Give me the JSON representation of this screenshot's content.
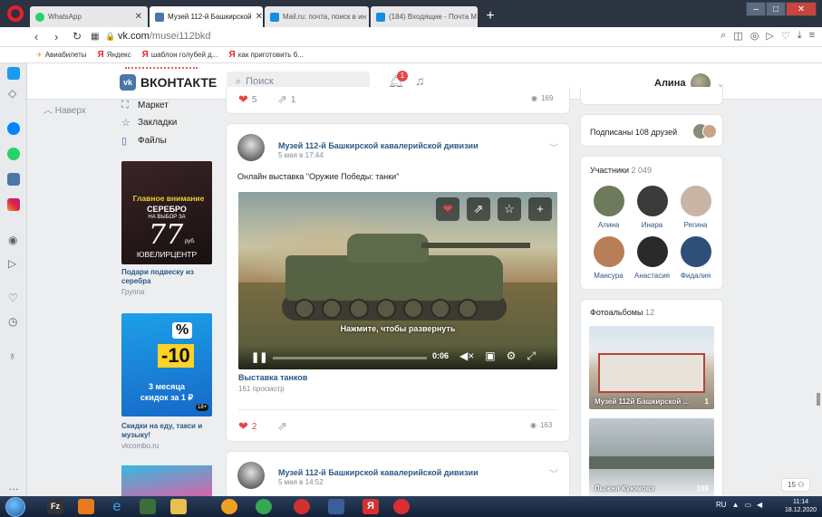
{
  "browser": {
    "tabs": [
      {
        "label": "WhatsApp",
        "color": "#25d366",
        "active": false
      },
      {
        "label": "Музей 112-й Башкирской",
        "color": "#4a76a8",
        "active": true
      },
      {
        "label": "Mail.ru: почта, поиск в ин",
        "color": "#168de2",
        "active": false
      },
      {
        "label": "(184) Входящие - Почта М",
        "color": "#168de2",
        "active": false
      }
    ],
    "new_tab": "+",
    "url_host": "vk.com",
    "url_path": "/musei112bkd",
    "bookmarks": [
      {
        "label": "Авиабилеты",
        "icon": "plane-icon"
      },
      {
        "label": "Яндекс",
        "icon": "yandex-icon"
      },
      {
        "label": "шаблон голубей д...",
        "icon": "yandex-icon"
      },
      {
        "label": "как приготовить б...",
        "icon": "yandex-icon"
      }
    ]
  },
  "vk": {
    "logo": "ВКОНТАКТЕ",
    "logo_mark": "vk",
    "search_placeholder": "Поиск",
    "notifications": "1",
    "user_name": "Алина",
    "back_top": "Наверх",
    "menu": [
      {
        "label": "Маркет",
        "icon": "bag-icon"
      },
      {
        "label": "Закладки",
        "icon": "star-icon"
      },
      {
        "label": "Файлы",
        "icon": "file-icon"
      }
    ],
    "ads": [
      {
        "img_line1": "Главное внимание",
        "img_line2": "СЕРЕБРО",
        "img_line3": "НА ВЫБОР ЗА",
        "img_price": "77",
        "img_unit": "руб.",
        "img_brand": "ЮВЕЛИРЦЕНТР",
        "title": "Подари подвеску из серебра",
        "sub": "Группа"
      },
      {
        "img_pct": "%",
        "img_big": "-10",
        "img_t1": "3 месяца",
        "img_t2": "скидок за 1 ₽",
        "img_age": "18+",
        "title": "Скидки на еду, такси и музыку!",
        "sub": "vkcombo.ru"
      }
    ]
  },
  "feed": {
    "prev_post": {
      "likes": "5",
      "reposts": "1",
      "views": "169"
    },
    "post": {
      "author": "Музей 112-й Башкирской кавалерийской дивизии",
      "date": "5 мая в 17:44",
      "text": "Онлайн выставка \"Оружие Победы: танки\"",
      "video_hint": "Нажмите, чтобы развернуть",
      "video_time": "0:06",
      "video_title": "Выставка танков",
      "video_views": "161 просмотр",
      "likes": "2",
      "views": "163"
    },
    "next_post": {
      "author": "Музей 112-й Башкирской кавалерийской дивизии",
      "date": "5 мая в 14:52"
    }
  },
  "right": {
    "friends_label": "Подписаны 108 друзей",
    "members_label": "Участники",
    "members_count": "2 049",
    "members": [
      {
        "name": "Алина",
        "color": "#6d7a5c"
      },
      {
        "name": "Инара",
        "color": "#3a3a3a"
      },
      {
        "name": "Регина",
        "color": "#c9b4a6"
      },
      {
        "name": "Мансура",
        "color": "#b87e58"
      },
      {
        "name": "Анастасия",
        "color": "#2a2a2a"
      },
      {
        "name": "Фидалия",
        "color": "#2f4f78"
      }
    ],
    "albums_label": "Фотоальбомы",
    "albums_count": "12",
    "albums": [
      {
        "caption": "Музей 112й Башкирской ...",
        "count": "1"
      },
      {
        "caption": "Лыжня Куюмова",
        "count": "199"
      }
    ]
  },
  "page_counter": "15",
  "taskbar": {
    "lang": "RU",
    "time": "11:14",
    "date": "18.12.2020"
  }
}
